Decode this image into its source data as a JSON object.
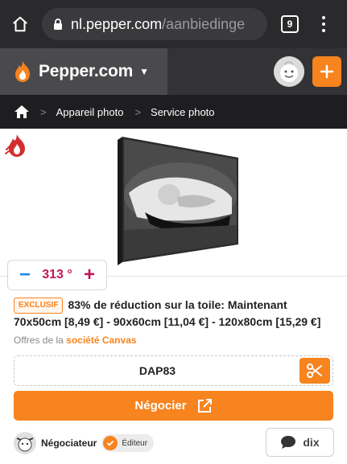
{
  "browser": {
    "url_host": "nl.pepper.com",
    "url_path": "/aanbiedinge",
    "tab_count": "9"
  },
  "site": {
    "brand": "Pepper.com"
  },
  "breadcrumb": {
    "items": [
      "Appareil photo",
      "Service photo"
    ]
  },
  "deal": {
    "temperature": "313 °",
    "badge": "EXCLUSIF",
    "title": "83% de réduction sur la toile: Maintenant 70x50cm [8,49 €] - 90x60cm [11,04 €] - 120x80cm [15,29 €]",
    "offers_prefix": "Offres de la",
    "company": "société Canvas",
    "code": "DAP83",
    "deal_button": "Négocier",
    "poster_name": "Négociateur",
    "poster_role": "Éditeur",
    "comments_count": "dix"
  },
  "colors": {
    "accent": "#f7841e",
    "hot_temperature": "#c2185b",
    "vote_down": "#1e88e5"
  },
  "icons": [
    "home-icon",
    "lock-icon",
    "tabs-icon",
    "more-vert-icon",
    "pepper-logo-icon",
    "caret-down-icon",
    "plus-icon",
    "breadcrumb-home-icon",
    "chevron-right-icon",
    "hot-flame-icon",
    "scissors-icon",
    "external-link-icon",
    "check-icon",
    "comment-icon"
  ]
}
